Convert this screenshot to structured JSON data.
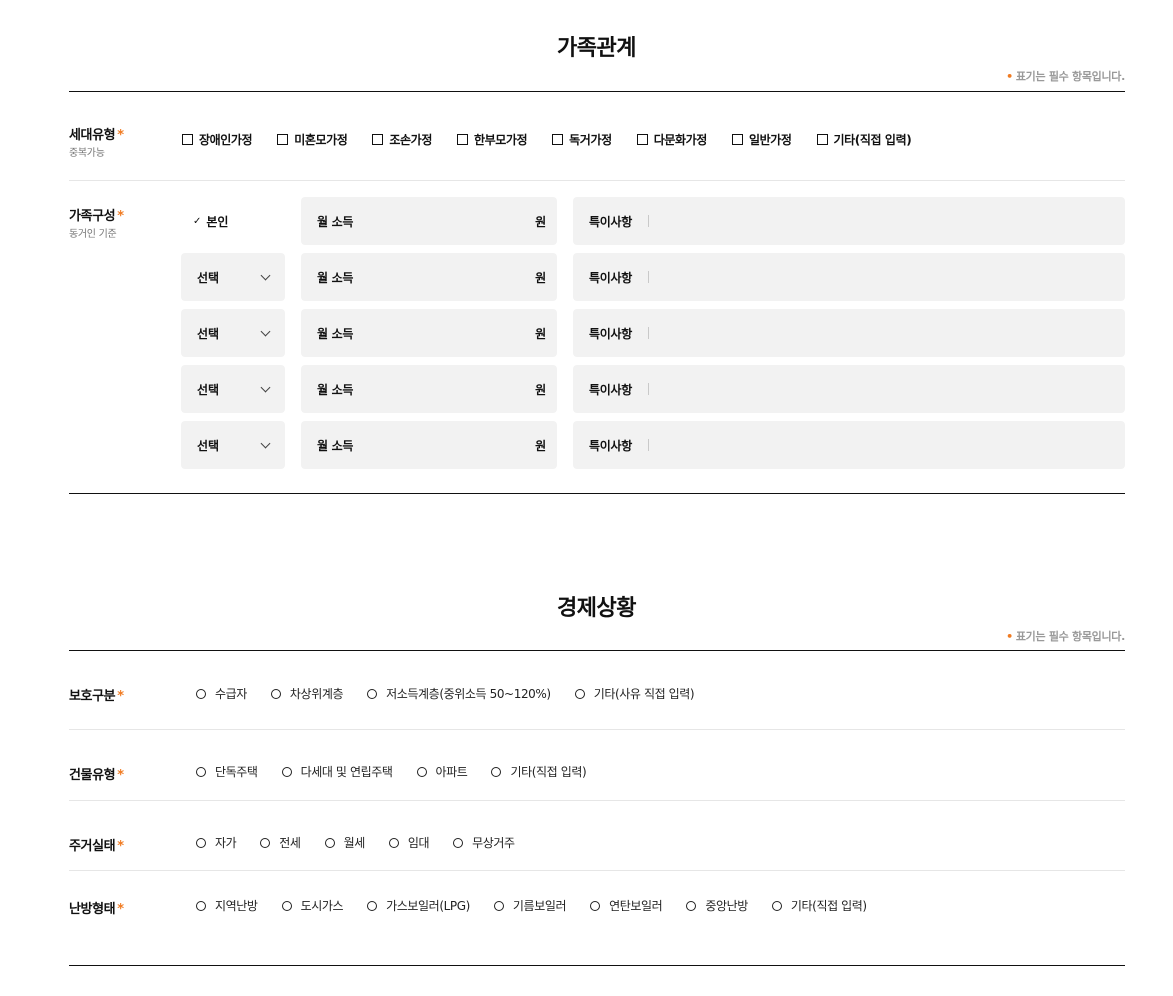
{
  "family_section": {
    "title": "가족관계",
    "required_note": "표기는 필수 항목입니다.",
    "household_type": {
      "label": "세대유형",
      "sub": "중복가능",
      "options": [
        "장애인가정",
        "미혼모가정",
        "조손가정",
        "한부모가정",
        "독거가정",
        "다문화가정",
        "일반가정",
        "기타(직접 입력)"
      ]
    },
    "family_composition": {
      "label": "가족구성",
      "sub": "동거인 기준",
      "self_label": "본인",
      "select_placeholder": "선택",
      "income_label": "월 소득",
      "income_unit": "원",
      "note_label": "특이사항"
    }
  },
  "economy_section": {
    "title": "경제상황",
    "required_note": "표기는 필수 항목입니다.",
    "protection": {
      "label": "보호구분",
      "options": [
        "수급자",
        "차상위계층",
        "저소득계층(중위소득 50~120%)",
        "기타(사유 직접 입력)"
      ]
    },
    "building": {
      "label": "건물유형",
      "options": [
        "단독주택",
        "다세대 및 연립주택",
        "아파트",
        "기타(직접 입력)"
      ]
    },
    "residence": {
      "label": "주거실태",
      "options": [
        "자가",
        "전세",
        "월세",
        "임대",
        "무상거주"
      ]
    },
    "heating": {
      "label": "난방형태",
      "options": [
        "지역난방",
        "도시가스",
        "가스보일러(LPG)",
        "기름보일러",
        "연탄보일러",
        "중앙난방",
        "기타(직접 입력)"
      ]
    }
  },
  "colors": {
    "accent": "#f07b22",
    "field_bg": "#f2f2f2",
    "text": "#111111",
    "note_text": "#9a9a9a"
  }
}
